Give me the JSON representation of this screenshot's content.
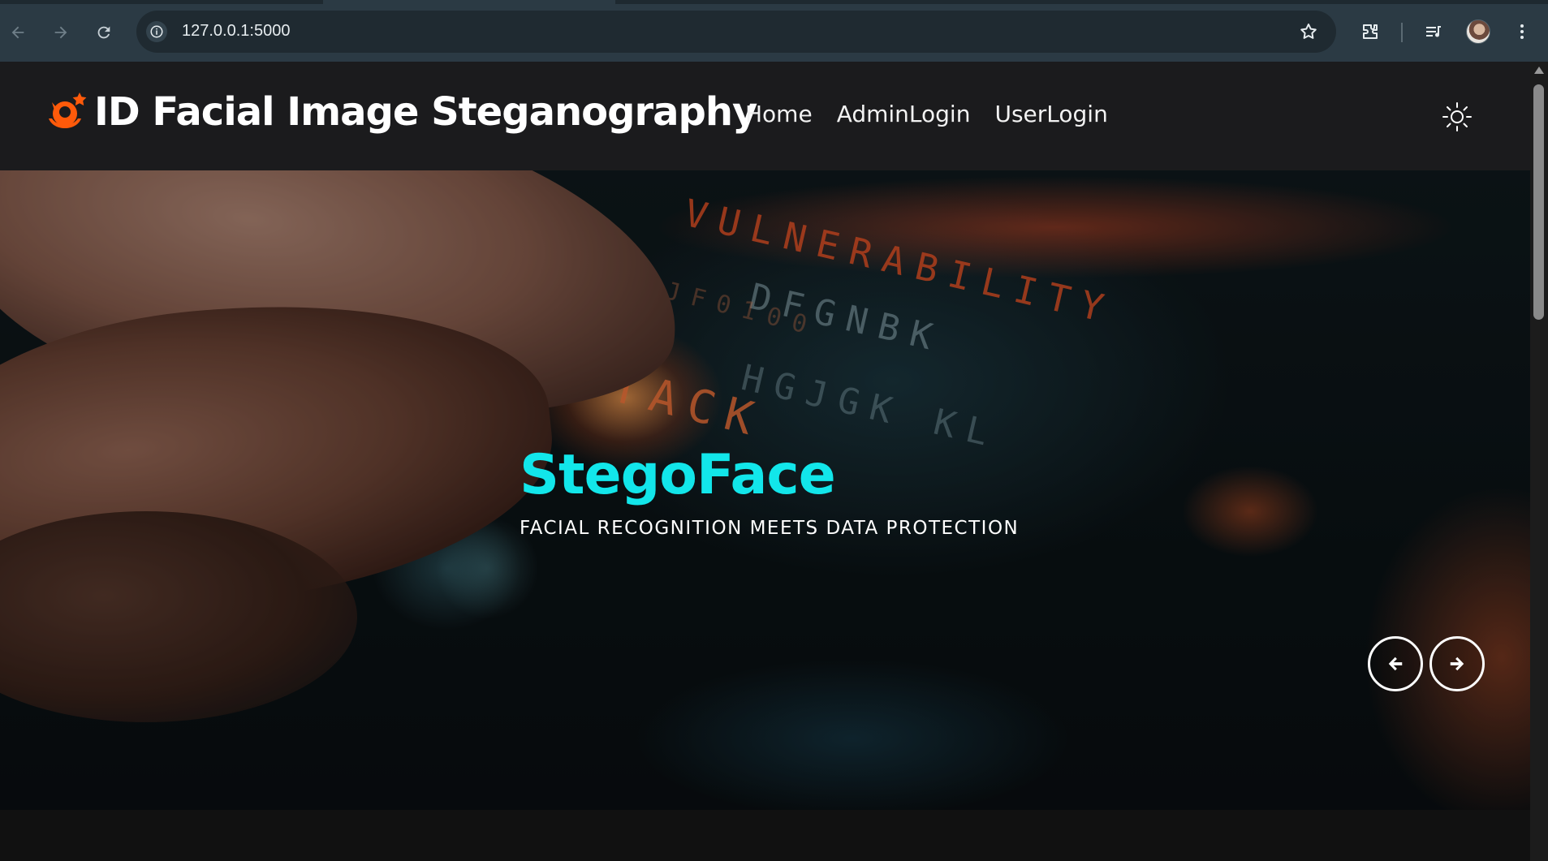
{
  "browser": {
    "url": "127.0.0.1:5000",
    "icons": [
      "back-arrow-icon",
      "forward-arrow-icon",
      "reload-icon",
      "site-info-icon",
      "bookmark-star-icon",
      "extensions-icon",
      "media-controls-icon",
      "profile-avatar",
      "kebab-menu-icon"
    ]
  },
  "site": {
    "brand_title": "ID Facial Image Steganography",
    "logo_icon": "face-star-logo-icon",
    "accent_color": "#ff5a0a",
    "nav": [
      {
        "label": "Home"
      },
      {
        "label": "AdminLogin"
      },
      {
        "label": "UserLogin"
      }
    ],
    "theme_toggle_icon": "sun-icon"
  },
  "hero": {
    "title": "StegoFace",
    "subtitle": "FACIAL RECOGNITION MEETS DATA PROTECTION",
    "title_color": "#12e6ea",
    "prev_icon": "arrow-left-icon",
    "next_icon": "arrow-right-icon"
  }
}
